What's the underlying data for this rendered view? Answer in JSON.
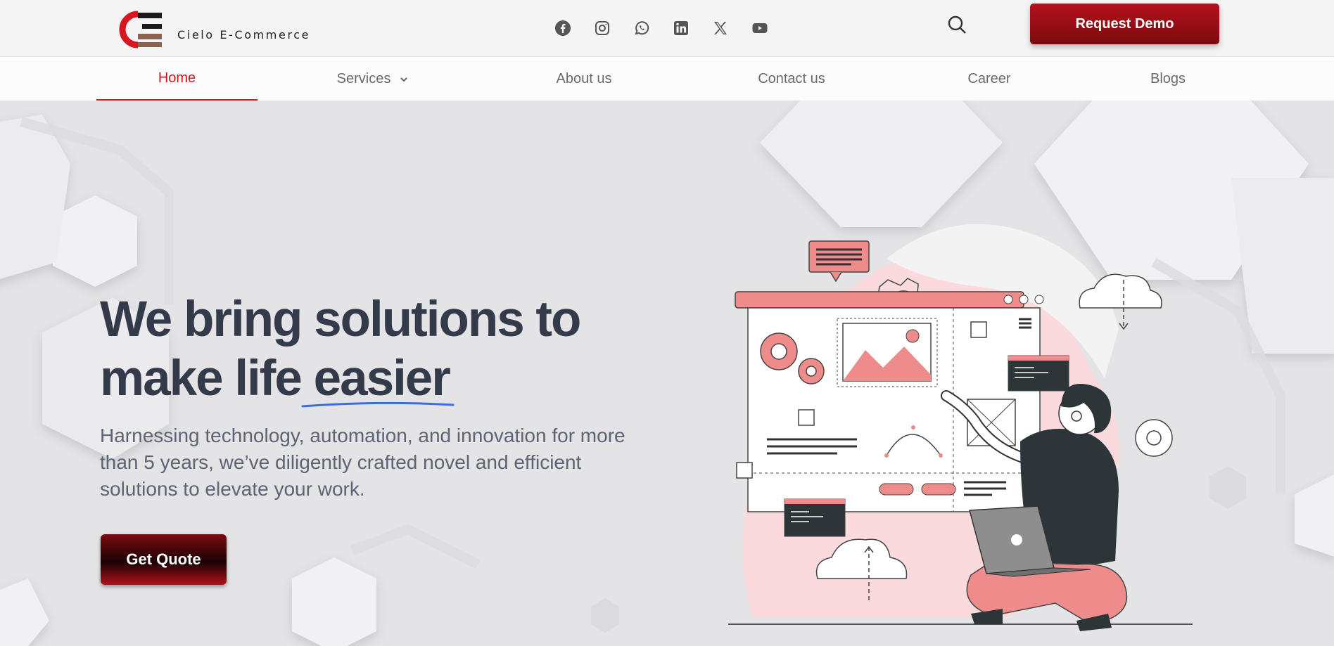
{
  "brand": {
    "name": "Cielo E-Commerce",
    "accent": "#c8161e"
  },
  "socials": [
    {
      "name": "facebook-icon"
    },
    {
      "name": "instagram-icon"
    },
    {
      "name": "whatsapp-icon"
    },
    {
      "name": "linkedin-icon"
    },
    {
      "name": "x-icon"
    },
    {
      "name": "youtube-icon"
    }
  ],
  "header": {
    "request_demo": "Request Demo"
  },
  "nav": {
    "items": [
      {
        "label": "Home",
        "active": true
      },
      {
        "label": "Services"
      },
      {
        "label": "About us"
      },
      {
        "label": "Contact us"
      },
      {
        "label": "Career"
      },
      {
        "label": "Blogs"
      }
    ]
  },
  "hero": {
    "headline_line1": "We bring solutions to",
    "headline_line2": "make life easier",
    "subtext": "Harnessing technology, automation, and innovation for more than 5 years, we’ve diligently crafted novel and efficient solutions to elevate your work.",
    "cta": "Get Quote"
  }
}
